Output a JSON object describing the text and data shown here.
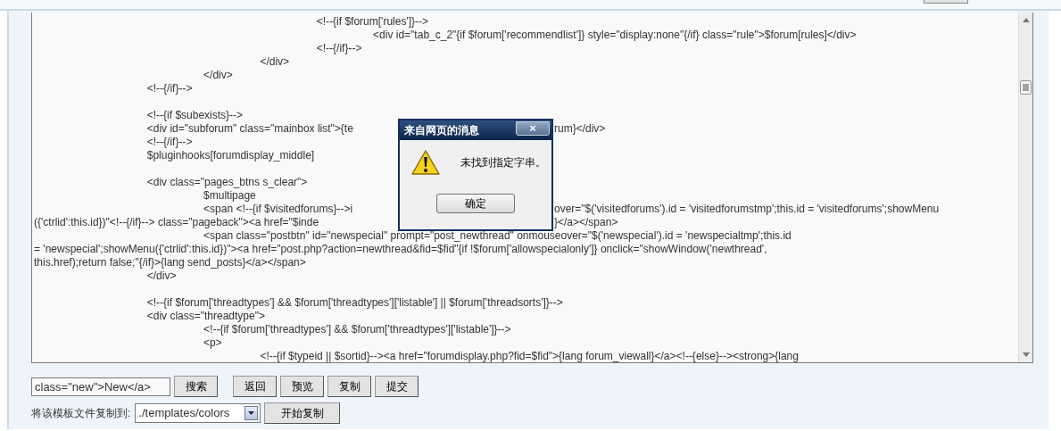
{
  "top_button": {
    "kind": "cut"
  },
  "editor": {
    "lines": [
      {
        "kind": "code",
        "text": "\t\t\t\t\t<!--{if $forum['rules']}-->"
      },
      {
        "kind": "code",
        "text": "\t\t\t\t\t\t<div id=\"tab_c_2\"{if $forum['recommendlist']} style=\"display:none\"{/if} class=\"rule\">$forum[rules]</div>"
      },
      {
        "kind": "code",
        "text": "\t\t\t\t\t<!--{/if}-->"
      },
      {
        "kind": "code",
        "text": "\t\t\t\t</div>"
      },
      {
        "kind": "code",
        "text": "\t\t\t</div>"
      },
      {
        "kind": "code",
        "text": "\t\t<!--{/if}-->"
      },
      {
        "kind": "blank"
      },
      {
        "kind": "code",
        "text": "\t\t<!--{if $subexists}-->"
      },
      {
        "kind": "code",
        "text": "\t\t<div id=\"subforum\" class=\"mainbox list\">{te",
        "after_dialog": "rum}</div>"
      },
      {
        "kind": "code",
        "text": "\t\t<!--{/if}-->"
      },
      {
        "kind": "code",
        "text": "\t\t$pluginhooks[forumdisplay_middle]"
      },
      {
        "kind": "blank"
      },
      {
        "kind": "code",
        "text": "\t\t<div class=\"pages_btns s_clear\">"
      },
      {
        "kind": "code",
        "text": "\t\t\t$multipage"
      },
      {
        "kind": "code",
        "text": "\t\t\t<span <!--{if $visitedforums}-->i",
        "after_dialog": "over=\"$('visitedforums').id = 'visitedforumstmp';this.id = 'visitedforums';showMenu"
      },
      {
        "kind": "code",
        "text": "({'ctrlid':this.id})\"<!--{/if}--> class=\"pageback\"><a href=\"$inde",
        "after_dialog": "}</a></span>"
      },
      {
        "kind": "code",
        "text": "\t\t\t<span class=\"postbtn\" id=\"newspecial\" prompt=\"post_newthread\" onmouseover=\"$('newspecial').id = 'newspecialtmp';this.id"
      },
      {
        "kind": "code",
        "text": "= 'newspecial';showMenu({'ctrlid':this.id})\"><a href=\"post.php?action=newthread&fid=$fid\"{if !$forum['allowspecialonly']} onclick=\"showWindow('newthread',"
      },
      {
        "kind": "code",
        "text": "this.href);return false;\"{/if}>{lang send_posts}</a></span>"
      },
      {
        "kind": "code",
        "text": "\t\t</div>"
      },
      {
        "kind": "blank"
      },
      {
        "kind": "code",
        "text": "\t\t<!--{if $forum['threadtypes'] && $forum['threadtypes']['listable'] || $forum['threadsorts']}-->"
      },
      {
        "kind": "code",
        "text": "\t\t<div class=\"threadtype\">"
      },
      {
        "kind": "code",
        "text": "\t\t\t<!--{if $forum['threadtypes'] && $forum['threadtypes']['listable']}-->"
      },
      {
        "kind": "code",
        "text": "\t\t\t<p>"
      },
      {
        "kind": "code",
        "text": "\t\t\t\t<!--{if $typeid || $sortid}--><a href=\"forumdisplay.php?fid=$fid\">{lang forum_viewall}</a><!--{else}--><strong>{lang"
      }
    ]
  },
  "dialog": {
    "title": "来自网页的消息",
    "close": "×",
    "message": "未找到指定字串。",
    "ok_button": "确定"
  },
  "search": {
    "value": "class=\"new\">New</a>",
    "button": "搜索"
  },
  "actions": [
    "返回",
    "预览",
    "复制",
    "提交"
  ],
  "copy": {
    "label": "将该模板文件复制到:",
    "select_value": "./templates/colors",
    "button": "开始复制"
  }
}
